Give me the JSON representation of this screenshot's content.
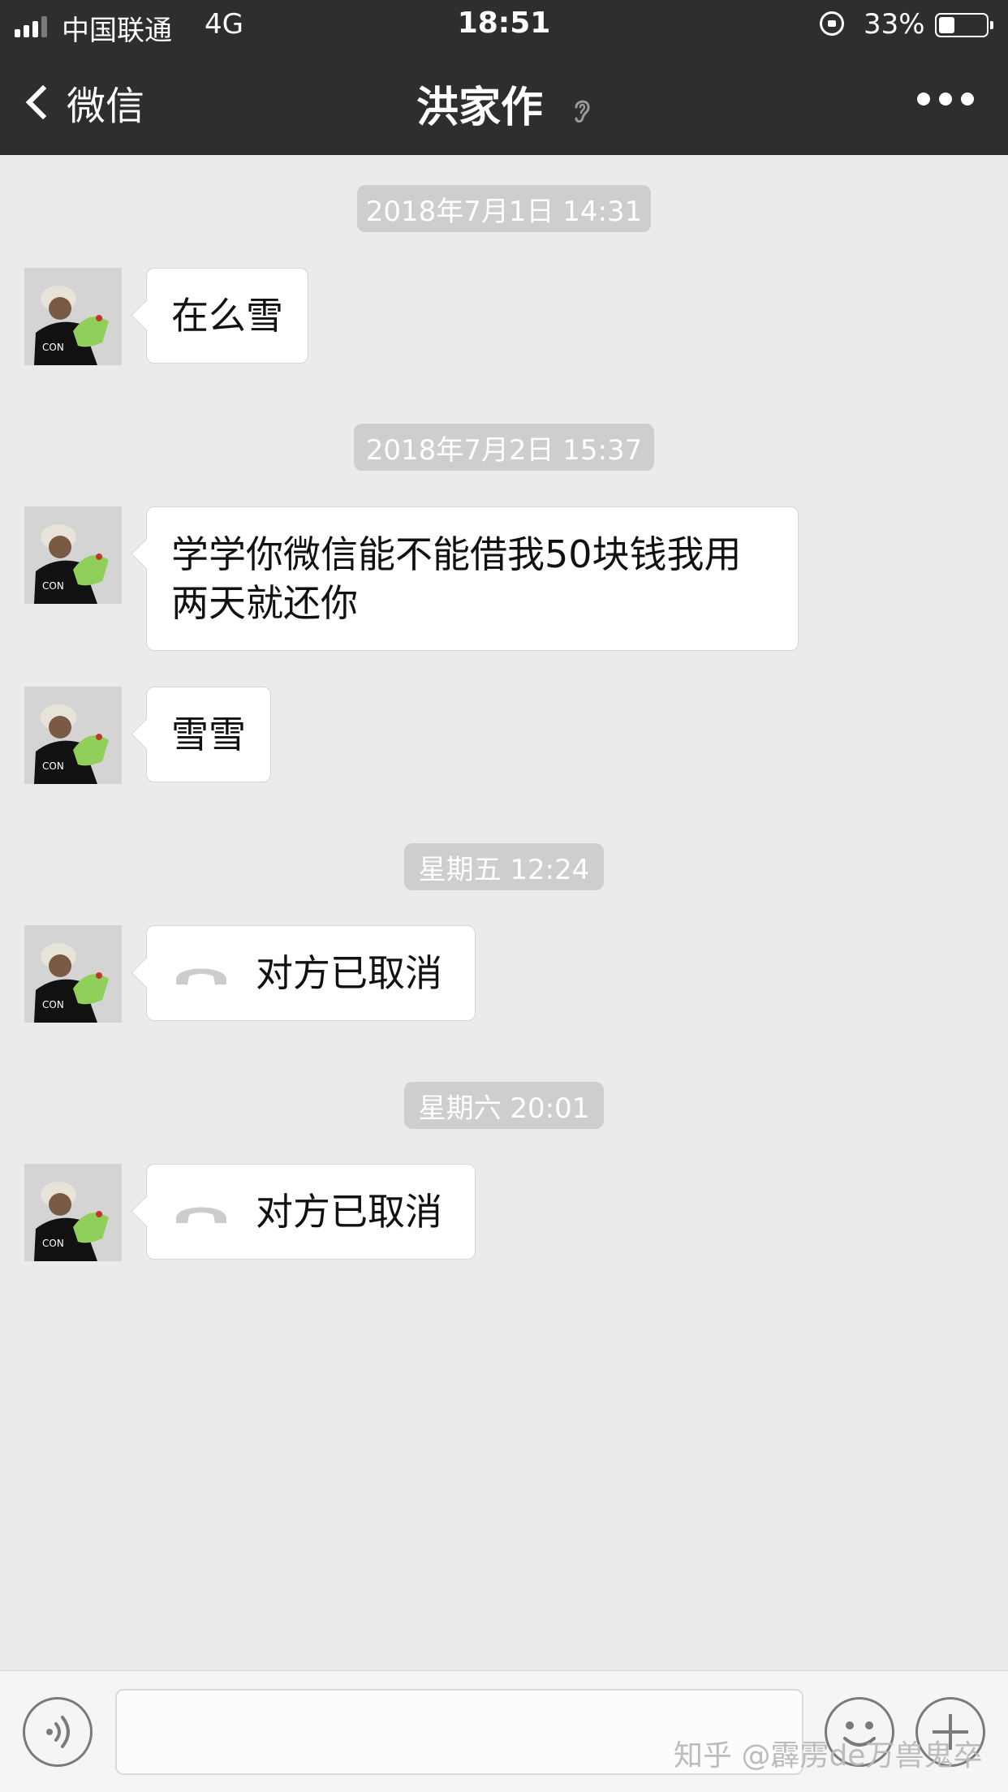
{
  "status_bar": {
    "carrier": "中国联通",
    "network": "4G",
    "time": "18:51",
    "battery": "33%",
    "battery_level": 0.33
  },
  "nav": {
    "back_label": "微信",
    "title": "洪家作",
    "mute_icon": "ear-icon",
    "more_icon": "ellipsis-icon"
  },
  "messages": [
    {
      "timestamp": "2018年7月1日 14:31",
      "text": "在么雪"
    },
    {
      "timestamp": "2018年7月2日 15:37",
      "text_lines": [
        "学学你微信能不能借我50块钱我用",
        "两天就还你"
      ]
    },
    {
      "text": "雪雪"
    },
    {
      "timestamp": "星期五 12:24",
      "call_status": "对方已取消"
    },
    {
      "timestamp": "星期六 20:01",
      "call_status": "对方已取消"
    }
  ],
  "input_bar": {
    "voice_icon": "voice-icon",
    "emoji_icon": "emoji-icon",
    "plus_icon": "plus-icon"
  },
  "watermark": "知乎 @霹雳de万兽鬼卒",
  "colors": {
    "topbar": "#2e2e2f",
    "chat_bg": "#ebebeb",
    "timestamp_bg": "#cecece",
    "bubble": "#ffffff"
  }
}
